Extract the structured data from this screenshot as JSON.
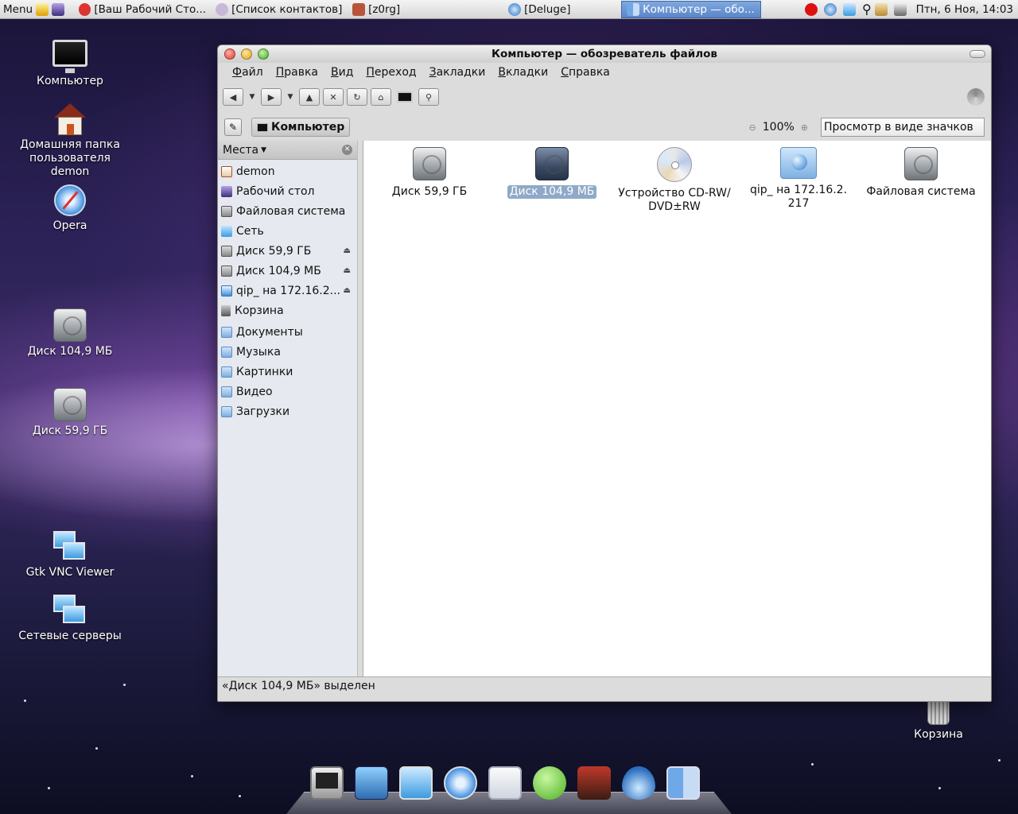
{
  "panel": {
    "menu_label": "Menu",
    "tasks": [
      {
        "label": "[Ваш Рабочий Сто..."
      },
      {
        "label": "[Список контактов]"
      },
      {
        "label": "[z0rg]"
      },
      {
        "label": "[Deluge]"
      },
      {
        "label": "Компьютер — обо..."
      }
    ],
    "clock": "Птн,  6 Ноя, 14:03"
  },
  "desktop": {
    "icons": [
      {
        "label": "Компьютер"
      },
      {
        "label": "Домашняя папка пользователя demon"
      },
      {
        "label": "Opera"
      },
      {
        "label": "Диск 104,9 МБ"
      },
      {
        "label": "Диск 59,9 ГБ"
      },
      {
        "label": "Gtk VNC Viewer"
      },
      {
        "label": "Сетевые серверы"
      },
      {
        "label": "Корзина"
      }
    ]
  },
  "window": {
    "title": "Компьютер — обозреватель файлов",
    "menu": [
      "Файл",
      "Правка",
      "Вид",
      "Переход",
      "Закладки",
      "Вкладки",
      "Справка"
    ],
    "location": "Компьютер",
    "zoom": "100%",
    "view_mode": "Просмотр в виде значков",
    "sidebar": {
      "header": "Места",
      "items": [
        {
          "label": "demon"
        },
        {
          "label": "Рабочий стол"
        },
        {
          "label": "Файловая система"
        },
        {
          "label": "Сеть"
        },
        {
          "label": "Диск 59,9 ГБ"
        },
        {
          "label": "Диск 104,9 МБ"
        },
        {
          "label": "qip_ на 172.16.2..."
        },
        {
          "label": "Корзина"
        },
        {
          "label": "Документы"
        },
        {
          "label": "Музыка"
        },
        {
          "label": "Картинки"
        },
        {
          "label": "Видео"
        },
        {
          "label": "Загрузки"
        }
      ]
    },
    "files": [
      {
        "label": "Диск 59,9 ГБ",
        "icon": "hdd-icon"
      },
      {
        "label": "Диск 104,9 МБ",
        "icon": "hdd-icon",
        "selected": true
      },
      {
        "label": "Устройство CD-RW/\nDVD±RW",
        "icon": "cdrom-icon"
      },
      {
        "label": "qip_ на 172.16.2.\n217",
        "icon": "network-share-icon"
      },
      {
        "label": "Файловая система",
        "icon": "hdd-icon"
      }
    ],
    "status": "«Диск 104,9 МБ» выделен"
  },
  "colors": {
    "selection": "#8fa9c8",
    "active_task": "#5a86c8"
  }
}
